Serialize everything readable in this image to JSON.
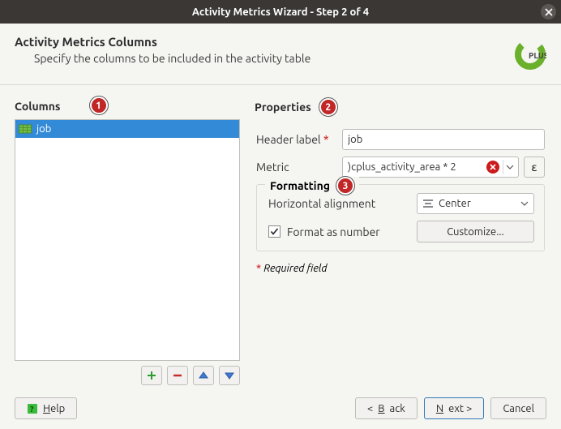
{
  "window": {
    "title": "Activity Metrics Wizard - Step 2 of 4"
  },
  "header": {
    "title": "Activity Metrics Columns",
    "subtitle": "Specify the columns to be included in the activity table"
  },
  "columns": {
    "label": "Columns",
    "items": [
      {
        "name": "job"
      }
    ]
  },
  "properties": {
    "label": "Properties",
    "header_label_label": "Header label",
    "header_label_value": "job",
    "metric_label": "Metric",
    "metric_value": ")cplus_activity_area * 2",
    "formatting": {
      "label": "Formatting",
      "halign_label": "Horizontal alignment",
      "halign_value": "Center",
      "format_number_label": "Format as number",
      "format_number_checked": true,
      "customize_label": "Customize..."
    },
    "required_note": "Required field"
  },
  "badges": {
    "columns": "1",
    "properties": "2",
    "formatting": "3"
  },
  "footer": {
    "help": "Help",
    "back": "< Back",
    "next": "Next >",
    "cancel": "Cancel"
  }
}
